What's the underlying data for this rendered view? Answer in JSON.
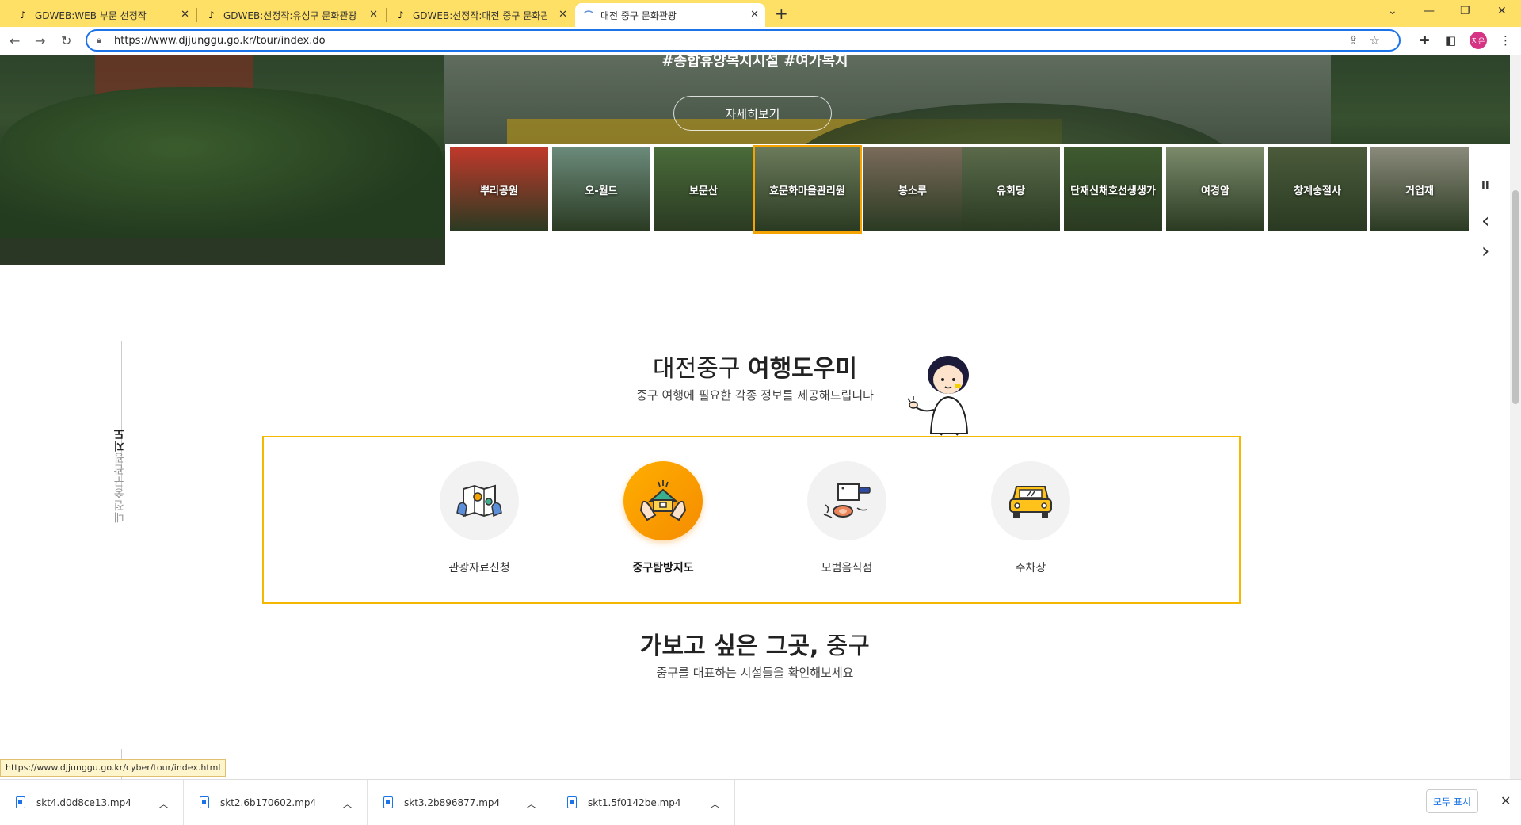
{
  "browser": {
    "tabs": [
      {
        "title": "GDWEB:WEB 부문 선정작",
        "active": false
      },
      {
        "title": "GDWEB:선정작:유성구 문화관광",
        "active": false
      },
      {
        "title": "GDWEB:선정작:대전 중구 문화관",
        "active": false
      },
      {
        "title": "대전 중구 문화관광",
        "active": true
      }
    ],
    "new_tab": "+",
    "url": "https://www.djjunggu.go.kr/tour/index.do",
    "profile_initials": "지은",
    "window_controls": [
      "⌄",
      "—",
      "❐",
      "✕"
    ]
  },
  "hero": {
    "tags": "#종합휴양복지시설 #여가복지",
    "detail_button": "자세히보기",
    "thumbnails": [
      {
        "label": "뿌리공원",
        "color": "#c0392b"
      },
      {
        "label": "오-월드",
        "color": "#6b8a7a"
      },
      {
        "label": "보문산",
        "color": "#4a6b3a"
      },
      {
        "label": "효문화마을관리원",
        "color": "#6b7a5a",
        "active": true
      },
      {
        "label": "봉소루",
        "color": "#7a6a5a"
      },
      {
        "label": "유회당",
        "color": "#5a6a4a"
      },
      {
        "label": "단재신채호선생생가",
        "color": "#3e5a30"
      },
      {
        "label": "여경암",
        "color": "#7a8a6a"
      },
      {
        "label": "창계숭절사",
        "color": "#4a5a3a"
      },
      {
        "label": "거업재",
        "color": "#8a8a7a"
      }
    ],
    "controls": {
      "pause": "II",
      "prev": "‹",
      "next": "›"
    }
  },
  "side_label": {
    "normal": "대전중구관광",
    "bold": "지도"
  },
  "helper": {
    "title_normal": "대전중구 ",
    "title_bold": "여행도우미",
    "subtitle": "중구 여행에 필요한 각종 정보를 제공해드립니다",
    "items": [
      {
        "label": "관광자료신청",
        "icon": "map-icon",
        "active": false
      },
      {
        "label": "중구탐방지도",
        "icon": "house-hands-icon",
        "active": true
      },
      {
        "label": "모범음식점",
        "icon": "cleaver-icon",
        "active": false
      },
      {
        "label": "주차장",
        "icon": "car-icon",
        "active": false
      }
    ]
  },
  "places": {
    "title_bold": "가보고 싶은 그곳,",
    "title_normal": " 중구",
    "subtitle": "중구를 대표하는 시설들을 확인해보세요"
  },
  "status_url": "https://www.djjunggu.go.kr/cyber/tour/index.html",
  "downloads": {
    "files": [
      "skt4.d0d8ce13.mp4",
      "skt2.6b170602.mp4",
      "skt3.2b896877.mp4",
      "skt1.5f0142be.mp4"
    ],
    "show_all": "모두 표시"
  }
}
